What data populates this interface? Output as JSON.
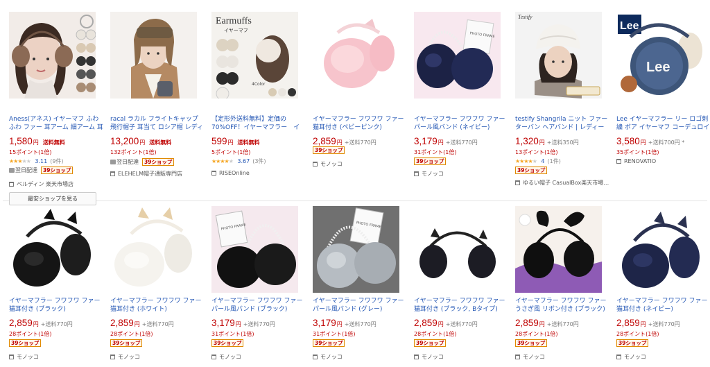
{
  "row1": [
    {
      "title": "Aness(アネス) イヤーマフ ふわふわ ファー 耳アーム 細アーム 耳あて …",
      "price": "1,580",
      "yen": "円",
      "free_shipping": "送料無料",
      "points": "15ポイント(1倍)",
      "rating": 3,
      "review_score": "3.11",
      "review_count": "(9件)",
      "nextday": "翌日配達",
      "badge": "39ショップ",
      "shop": "ベルディン 楽天市場店",
      "cheap_button": "最安ショップを見る",
      "thumb_icon": "woman-earmuff-photo-icon"
    },
    {
      "title": "racal ラカル フライトキャップ 飛行帽子 耳当て ロシア帽 レディース …",
      "price": "13,200",
      "yen": "円",
      "free_shipping": "送料無料",
      "points": "132ポイント(1倍)",
      "nextday": "翌日配達",
      "badge": "39ショップ",
      "shop": "ELEHELM帽子通販専門店",
      "thumb_icon": "woman-flight-cap-photo-icon"
    },
    {
      "title": "【定形外送料無料】定価の70%OFF！イヤーマフラー　イヤ…",
      "price": "599",
      "yen": "円",
      "free_shipping": "送料無料",
      "points": "5ポイント(1倍)",
      "rating": 4,
      "review_score": "3.67",
      "review_count": "(3件)",
      "shop": "RISEOnline",
      "thumb_brand": "Earmuffs",
      "thumb_sub": "イヤーマフ",
      "thumb_colors": "4Color",
      "thumb_icon": "earmuff-colors-photo-icon"
    },
    {
      "title": "イヤーマフラー フワフワ ファー 猫耳付き (ベビーピンク)",
      "price": "2,859",
      "yen": "円",
      "shipping": "+送料770円",
      "badge": "39ショップ",
      "shop": "モノッコ",
      "thumb_icon": "pink-cat-earmuff-icon"
    },
    {
      "title": "イヤーマフラー フワフワ ファー パール風バンド (ネイビー)",
      "price": "3,179",
      "yen": "円",
      "shipping": "+送料770円",
      "points": "31ポイント(1倍)",
      "badge": "39ショップ",
      "shop": "モノッコ",
      "thumb_frame": "PHOTO FRAME",
      "thumb_icon": "navy-pearl-earmuff-icon"
    },
    {
      "title": "testify Shangrila ニット ファー ターバン ヘアバンド | レディース 秋 …",
      "price": "1,320",
      "yen": "円",
      "shipping": "+送料350円",
      "points": "13ポイント(1倍)",
      "rating": 4,
      "review_score": "4",
      "review_count": "(1件)",
      "badge": "39ショップ",
      "shop": "ゆるい帽子 CasualBox楽天市場…",
      "thumb_brand": "Testify",
      "thumb_icon": "woman-knit-turban-photo-icon"
    },
    {
      "title": "Lee イヤーマフラー リー ロゴ刺繍 ボア イヤーマフ コーデュロイ イヤー…",
      "price": "3,580",
      "yen": "円",
      "shipping": "+送料700円 *",
      "points": "35ポイント(1倍)",
      "shop": "RENOVATIO",
      "thumb_brand": "Lee",
      "thumb_icon": "lee-denim-earmuff-icon"
    }
  ],
  "row2": [
    {
      "title": "イヤーマフラー フワフワ ファー 猫耳付き (ブラック)",
      "price": "2,859",
      "yen": "円",
      "shipping": "+送料770円",
      "points": "28ポイント(1倍)",
      "badge": "39ショップ",
      "shop": "モノッコ",
      "thumb_icon": "black-cat-earmuff-icon"
    },
    {
      "title": "イヤーマフラー フワフワ ファー 猫耳付き (ホワイト)",
      "price": "2,859",
      "yen": "円",
      "shipping": "+送料770円",
      "points": "28ポイント(1倍)",
      "badge": "39ショップ",
      "shop": "モノッコ",
      "thumb_icon": "white-cat-earmuff-icon"
    },
    {
      "title": "イヤーマフラー フワフワ ファー パール風バンド (ブラック)",
      "price": "3,179",
      "yen": "円",
      "shipping": "+送料770円",
      "points": "31ポイント(1倍)",
      "badge": "39ショップ",
      "shop": "モノッコ",
      "thumb_frame": "PHOTO FRAME",
      "thumb_icon": "black-pearl-earmuff-icon"
    },
    {
      "title": "イヤーマフラー フワフワ ファー パール風バンド (グレー)",
      "price": "3,179",
      "yen": "円",
      "shipping": "+送料770円",
      "points": "31ポイント(1倍)",
      "badge": "39ショップ",
      "shop": "モノッコ",
      "thumb_frame": "PHOTO FRAME",
      "thumb_icon": "grey-pearl-earmuff-icon"
    },
    {
      "title": "イヤーマフラー フワフワ ファー 猫耳付き (ブラック, Bタイプ)",
      "price": "2,859",
      "yen": "円",
      "shipping": "+送料770円",
      "points": "28ポイント(1倍)",
      "badge": "39ショップ",
      "shop": "モノッコ",
      "thumb_icon": "black-cat-earmuff-b-icon"
    },
    {
      "title": "イヤーマフラー フワフワ ファー うさぎ風 リボン付き (ブラック)",
      "price": "2,859",
      "yen": "円",
      "shipping": "+送料770円",
      "points": "28ポイント(1倍)",
      "badge": "39ショップ",
      "shop": "モノッコ",
      "thumb_icon": "black-bunny-earmuff-icon"
    },
    {
      "title": "イヤーマフラー フワフワ ファー 猫耳付き (ネイビー)",
      "price": "2,859",
      "yen": "円",
      "shipping": "+送料770円",
      "points": "28ポイント(1倍)",
      "badge": "39ショップ",
      "shop": "モノッコ",
      "thumb_icon": "navy-cat-earmuff-icon"
    }
  ],
  "colors": {
    "link": "#2356b4",
    "price": "#bf0000",
    "star": "#f5a623",
    "badge_border": "#e08a00"
  }
}
